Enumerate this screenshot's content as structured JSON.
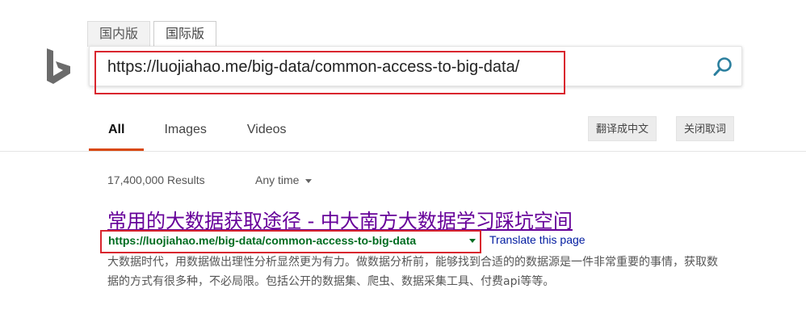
{
  "logo": {
    "icon": "bing-logo-icon",
    "color": "#6b6b6b"
  },
  "market_tabs": [
    {
      "label": "国内版"
    },
    {
      "label": "国际版"
    }
  ],
  "search": {
    "value": "https://luojiahao.me/big-data/common-access-to-big-data/",
    "icon": "search-icon",
    "icon_color": "#2b7f9e"
  },
  "scopes": [
    {
      "label": "All"
    },
    {
      "label": "Images"
    },
    {
      "label": "Videos"
    }
  ],
  "actions": {
    "translate_to_chinese": "翻译成中文",
    "close_word_lookup": "关闭取词"
  },
  "results_info": {
    "count": "17,400,000 Results",
    "time_filter": "Any time"
  },
  "result": {
    "title": "常用的大数据获取途径 - 中大南方大数据学习踩坑空间",
    "url": "https://luojiahao.me/big-data/common-access-to-big-data",
    "translate_label": "Translate this page",
    "snippet": "大数据时代，用数据做出理性分析显然更为有力。做数据分析前，能够找到合适的的数据源是一件非常重要的事情，获取数据的方式有很多种，不必局限。包括公开的数据集、爬虫、数据采集工具、付费api等等。"
  },
  "colors": {
    "highlight_box": "#d9262e",
    "active_scope_underline": "#d9480f",
    "visited_link": "#660099",
    "url_green": "#006d21",
    "translate_link": "#001ba0"
  }
}
